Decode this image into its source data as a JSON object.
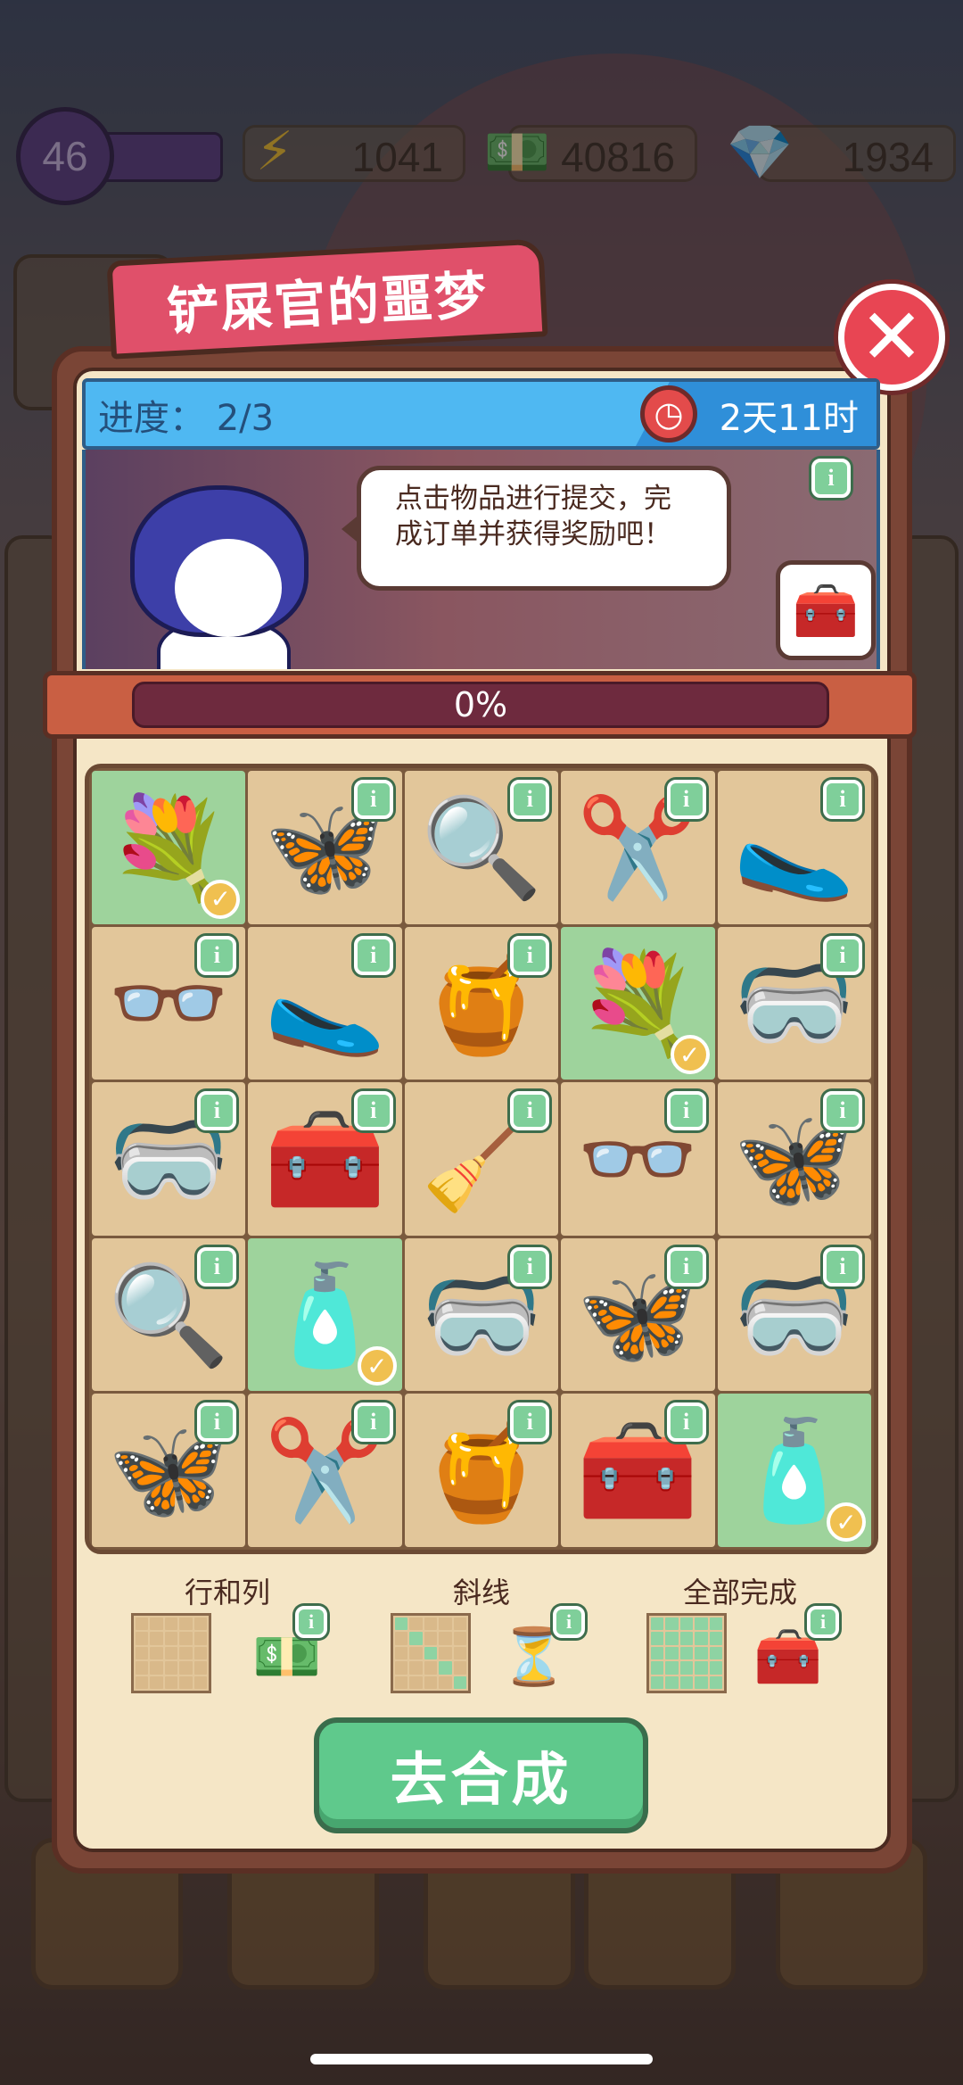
{
  "status_bar": {
    "level": "46",
    "energy": "1041",
    "cash": "40816",
    "gems": "1934"
  },
  "event": {
    "title": "铲屎官的噩梦",
    "progress_label": "进度：",
    "progress_value": "2/3",
    "time_left": "2天11时",
    "speech": "点击物品进行提交，完成订单并获得奖励吧！",
    "percent": "0%",
    "percent_value": 0
  },
  "grid": {
    "rows": [
      [
        {
          "name": "flower-basket",
          "emoji": "💐",
          "done": true
        },
        {
          "name": "moth",
          "emoji": "🦋",
          "done": false
        },
        {
          "name": "magnifier",
          "emoji": "🔍",
          "done": false
        },
        {
          "name": "pruning-shears",
          "emoji": "✂️",
          "done": false
        },
        {
          "name": "grass-slipper",
          "emoji": "🥿",
          "done": false
        }
      ],
      [
        {
          "name": "glasses",
          "emoji": "👓",
          "done": false
        },
        {
          "name": "grass-slipper",
          "emoji": "🥿",
          "done": false
        },
        {
          "name": "honey-jar",
          "emoji": "🍯",
          "done": false
        },
        {
          "name": "flower-basket",
          "emoji": "💐",
          "done": true
        },
        {
          "name": "goggles-bush",
          "emoji": "🥽",
          "done": false
        }
      ],
      [
        {
          "name": "goggles-bush",
          "emoji": "🥽",
          "done": false
        },
        {
          "name": "first-aid-kit",
          "emoji": "🧰",
          "done": false
        },
        {
          "name": "broom",
          "emoji": "🧹",
          "done": false
        },
        {
          "name": "glasses",
          "emoji": "👓",
          "done": false
        },
        {
          "name": "moth",
          "emoji": "🦋",
          "done": false
        }
      ],
      [
        {
          "name": "magnifier",
          "emoji": "🔍",
          "done": false
        },
        {
          "name": "lotion-bottle",
          "emoji": "🧴",
          "done": true
        },
        {
          "name": "goggles-bush",
          "emoji": "🥽",
          "done": false
        },
        {
          "name": "cute-moth",
          "emoji": "🦋",
          "done": false
        },
        {
          "name": "goggles-bush",
          "emoji": "🥽",
          "done": false
        }
      ],
      [
        {
          "name": "cute-moth",
          "emoji": "🦋",
          "done": false
        },
        {
          "name": "pruning-shears",
          "emoji": "✂️",
          "done": false
        },
        {
          "name": "honey-jar",
          "emoji": "🍯",
          "done": false
        },
        {
          "name": "first-aid-kit",
          "emoji": "🧰",
          "done": false
        },
        {
          "name": "lotion-bottle",
          "emoji": "🧴",
          "done": true
        }
      ]
    ]
  },
  "rewards": [
    {
      "label": "行和列",
      "icon": "cash-icon",
      "emoji": "💵"
    },
    {
      "label": "斜线",
      "icon": "hourglass-icon",
      "emoji": "⏳"
    },
    {
      "label": "全部完成",
      "icon": "treasure-chest-icon",
      "emoji": "🧰"
    }
  ],
  "main_button": "去合成",
  "colors": {
    "title_tab": "#e0506a",
    "header_blue": "#4fb8f2",
    "done_cell": "#9ed39c",
    "button_green": "#5fc98c",
    "close_red": "#e84553"
  }
}
